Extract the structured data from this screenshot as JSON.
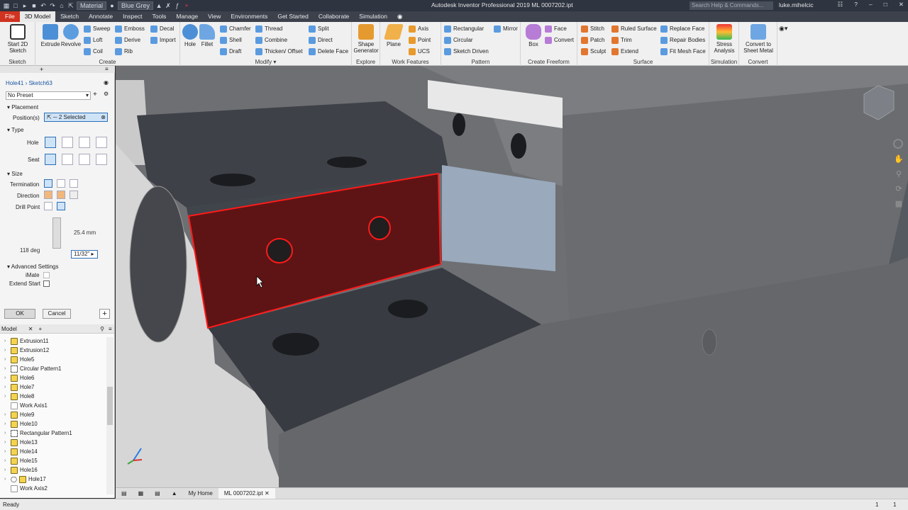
{
  "app": {
    "title": "Autodesk Inventor Professional 2019   ML 0007202.ipt",
    "material": "Material",
    "appearance": "Blue Grey",
    "search_placeholder": "Search Help & Commands...",
    "user": "luke.mihelcic"
  },
  "tabs": [
    "File",
    "3D Model",
    "Sketch",
    "Annotate",
    "Inspect",
    "Tools",
    "Manage",
    "View",
    "Environments",
    "Get Started",
    "Collaborate",
    "Simulation"
  ],
  "active_tab": "3D Model",
  "ribbon": {
    "sketch": {
      "label": "Sketch",
      "start_sketch": "Start 2D Sketch"
    },
    "create": {
      "label": "Create",
      "extrude": "Extrude",
      "revolve": "Revolve",
      "sweep": "Sweep",
      "loft": "Loft",
      "coil": "Coil",
      "emboss": "Emboss",
      "derive": "Derive",
      "rib": "Rib",
      "decal": "Decal",
      "import": "Import"
    },
    "modify": {
      "label": "Modify",
      "hole": "Hole",
      "fillet": "Fillet",
      "chamfer": "Chamfer",
      "shell": "Shell",
      "draft": "Draft",
      "thread": "Thread",
      "combine": "Combine",
      "thicken": "Thicken/ Offset",
      "split": "Split",
      "direct": "Direct",
      "delete_face": "Delete Face"
    },
    "explore": {
      "label": "Explore",
      "shape_generator": "Shape Generator"
    },
    "work_features": {
      "label": "Work Features",
      "plane": "Plane",
      "axis": "Axis",
      "point": "Point",
      "ucs": "UCS"
    },
    "pattern": {
      "label": "Pattern",
      "rectangular": "Rectangular",
      "circular": "Circular",
      "sketch_driven": "Sketch Driven",
      "mirror": "Mirror"
    },
    "create_freeform": {
      "label": "Create Freeform",
      "box": "Box",
      "face": "Face",
      "convert": "Convert"
    },
    "surface": {
      "label": "Surface",
      "stitch": "Stitch",
      "patch": "Patch",
      "sculpt": "Sculpt",
      "ruled_surface": "Ruled Surface",
      "trim": "Trim",
      "extend": "Extend",
      "replace_face": "Replace Face",
      "repair_bodies": "Repair Bodies",
      "fit_mesh_face": "Fit Mesh Face"
    },
    "simulation": {
      "label": "Simulation",
      "stress_analysis": "Stress Analysis"
    },
    "convert": {
      "label": "Convert",
      "sheet_metal": "Convert to Sheet Metal"
    }
  },
  "properties": {
    "breadcrumb": "Hole41 › Sketch63",
    "preset": "No Preset",
    "placement_header": "Placement",
    "positions_label": "Position(s)",
    "positions_value": "2 Selected",
    "type_header": "Type",
    "hole_label": "Hole",
    "seat_label": "Seat",
    "size_header": "Size",
    "termination_label": "Termination",
    "direction_label": "Direction",
    "drill_point_label": "Drill Point",
    "depth_value": "25.4 mm",
    "angle_value": "118 deg",
    "diameter_value": "11/32\"",
    "advanced_header": "Advanced Settings",
    "imate_label": "iMate",
    "extend_start_label": "Extend Start",
    "ok": "OK",
    "cancel": "Cancel"
  },
  "browser": {
    "tab": "Model",
    "items": [
      "Extrusion11",
      "Extrusion12",
      "Hole5",
      "Circular Pattern1",
      "Hole6",
      "Hole7",
      "Hole8",
      "Work Axis1",
      "Hole9",
      "Hole10",
      "Rectangular Pattern1",
      "Hole13",
      "Hole14",
      "Hole15",
      "Hole16",
      "Hole17",
      "Work Axis2"
    ]
  },
  "docs": {
    "home": "My Home",
    "file": "ML 0007202.ipt"
  },
  "status": {
    "text": "Ready",
    "n1": "1",
    "n2": "1"
  },
  "colors": {
    "file_tab": "#d0331f",
    "selection": "#e31b1b",
    "accent": "#2b6fb6"
  }
}
